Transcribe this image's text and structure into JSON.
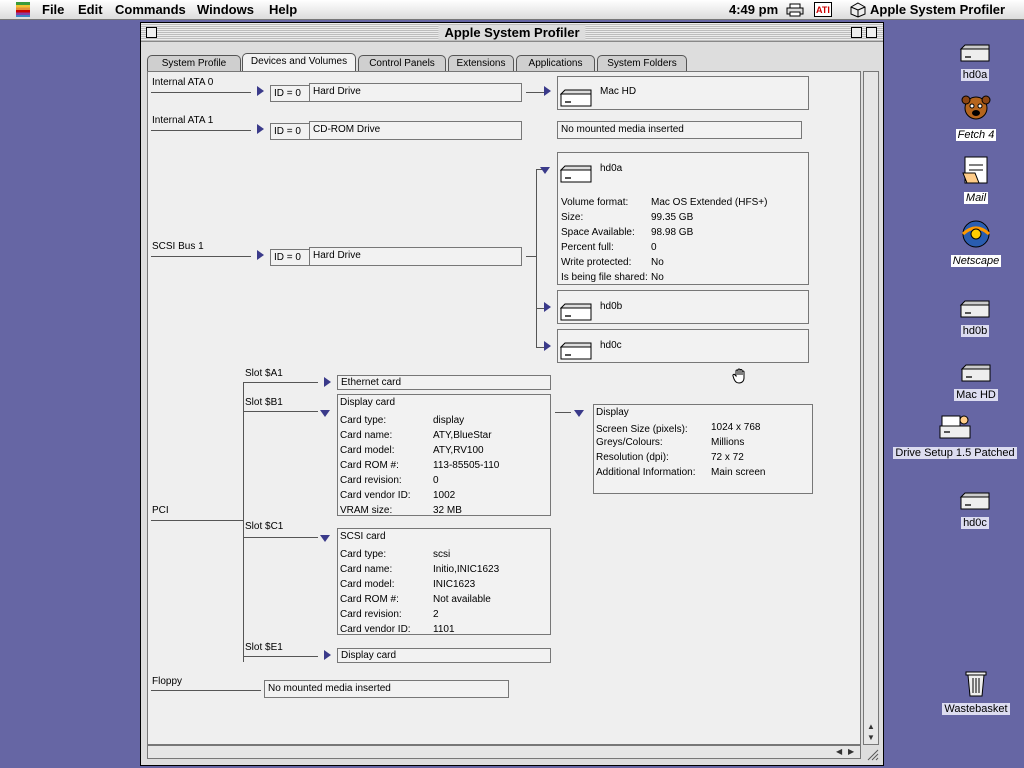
{
  "menubar": {
    "items": [
      "File",
      "Edit",
      "Commands",
      "Windows",
      "Help"
    ],
    "clock": "4:49 pm",
    "app_name": "Apple System Profiler"
  },
  "window": {
    "title": "Apple System Profiler",
    "tabs": [
      "System Profile",
      "Devices and Volumes",
      "Control Panels",
      "Extensions",
      "Applications",
      "System Folders"
    ],
    "active_tab": "Devices and Volumes"
  },
  "devices": {
    "ata0": {
      "bus": "Internal ATA 0",
      "id": "ID = 0",
      "device": "Hard Drive",
      "volume": "Mac HD"
    },
    "ata1": {
      "bus": "Internal ATA 1",
      "id": "ID = 0",
      "device": "CD-ROM Drive",
      "media": "No mounted media inserted"
    },
    "scsi": {
      "bus": "SCSI Bus 1",
      "id": "ID = 0",
      "device": "Hard Drive",
      "volumes": [
        {
          "name": "hd0a",
          "details": [
            {
              "k": "Volume format:",
              "v": "Mac OS Extended (HFS+)"
            },
            {
              "k": "Size:",
              "v": "99.35 GB"
            },
            {
              "k": "Space Available:",
              "v": "98.98 GB"
            },
            {
              "k": "Percent full:",
              "v": "0"
            },
            {
              "k": "Write protected:",
              "v": "No"
            },
            {
              "k": "Is being file shared:",
              "v": "No"
            }
          ]
        },
        {
          "name": "hd0b"
        },
        {
          "name": "hd0c"
        }
      ]
    },
    "pci": {
      "bus": "PCI",
      "slots": [
        {
          "slot": "Slot $A1",
          "card": "Ethernet card"
        },
        {
          "slot": "Slot $B1",
          "card": "Display card",
          "details": [
            {
              "k": "Card type:",
              "v": "display"
            },
            {
              "k": "Card name:",
              "v": "ATY,BlueStar"
            },
            {
              "k": "Card model:",
              "v": "ATY,RV100"
            },
            {
              "k": "Card ROM #:",
              "v": "113-85505-110"
            },
            {
              "k": "Card revision:",
              "v": "0"
            },
            {
              "k": "Card vendor ID:",
              "v": "1002"
            },
            {
              "k": "VRAM size:",
              "v": "32 MB"
            }
          ],
          "display": {
            "title": "Display",
            "details": [
              {
                "k": "Screen Size (pixels):",
                "v": "1024 x 768"
              },
              {
                "k": "Greys/Colours:",
                "v": "Millions"
              },
              {
                "k": "Resolution (dpi):",
                "v": "72 x 72"
              },
              {
                "k": "Additional Information:",
                "v": "Main screen"
              }
            ]
          }
        },
        {
          "slot": "Slot $C1",
          "card": "SCSI card",
          "details": [
            {
              "k": "Card type:",
              "v": "scsi"
            },
            {
              "k": "Card name:",
              "v": "Initio,INIC1623"
            },
            {
              "k": "Card model:",
              "v": "INIC1623"
            },
            {
              "k": "Card ROM #:",
              "v": "Not available"
            },
            {
              "k": "Card revision:",
              "v": "2"
            },
            {
              "k": "Card vendor ID:",
              "v": "1101"
            }
          ]
        },
        {
          "slot": "Slot $E1",
          "card": "Display card"
        }
      ]
    },
    "floppy": {
      "bus": "Floppy",
      "media": "No mounted media inserted"
    }
  },
  "desktop": {
    "icons": [
      "hd0a",
      "Fetch 4",
      "Mail",
      "Netscape",
      "hd0b",
      "Mac HD",
      "Drive Setup 1.5 Patched",
      "hd0c",
      "Wastebasket"
    ]
  }
}
